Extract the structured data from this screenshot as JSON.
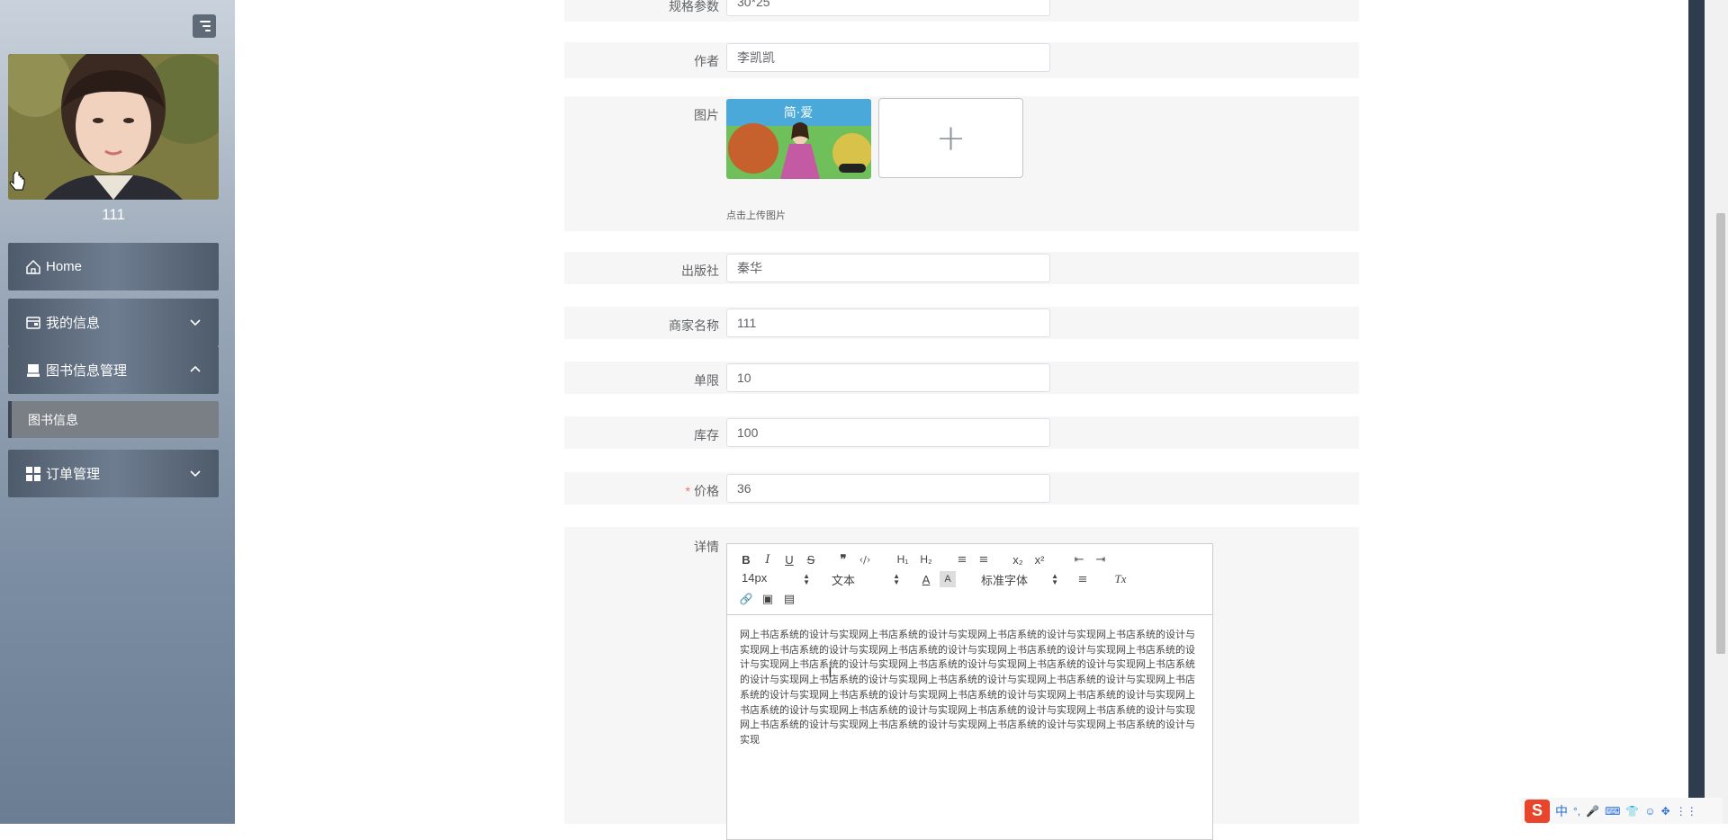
{
  "sidebar": {
    "username": "111",
    "nav": [
      {
        "label": "Home",
        "icon": "home-icon"
      },
      {
        "label": "我的信息",
        "icon": "wallet-icon"
      },
      {
        "label": "图书信息管理",
        "icon": "archive-icon"
      },
      {
        "label": "订单管理",
        "icon": "grid-icon"
      }
    ],
    "sub_item": {
      "label": "图书信息"
    }
  },
  "form": {
    "spec": {
      "label": "规格参数",
      "value": "30*25"
    },
    "author": {
      "label": "作者",
      "value": "李凯凯"
    },
    "image": {
      "label": "图片",
      "hint": "点击上传图片",
      "plus": "+",
      "cover_text": "简·爱"
    },
    "publisher": {
      "label": "出版社",
      "value": "秦华"
    },
    "merchant": {
      "label": "商家名称",
      "value": "111"
    },
    "limit": {
      "label": "单限",
      "value": "10"
    },
    "stock": {
      "label": "库存",
      "value": "100"
    },
    "price": {
      "label": "价格",
      "value": "36",
      "required_mark": "*"
    },
    "detail": {
      "label": "详情",
      "toolbar": {
        "bold": "B",
        "italic": "I",
        "underline": "U",
        "strike": "S",
        "quote": "❞",
        "code": "‹/›",
        "h1": "H₁",
        "h2": "H₂",
        "ordered": "≡",
        "bullet": "≡",
        "sub": "x₂",
        "sup": "x²",
        "outdent": "⇤",
        "indent": "⇥",
        "size": "14px",
        "format": "文本",
        "font": "标准字体",
        "color": "A",
        "bg": "A",
        "align": "≡",
        "clean": "Tx",
        "link": "🔗",
        "image": "▣",
        "video": "▤"
      },
      "content": "网上书店系统的设计与实现网上书店系统的设计与实现网上书店系统的设计与实现网上书店系统的设计与实现网上书店系统的设计与实现网上书店系统的设计与实现网上书店系统的设计与实现网上书店系统的设计与实现网上书店系统的设计与实现网上书店系统的设计与实现网上书店系统的设计与实现网上书店系统的设计与实现网上书店系统的设计与实现网上书店系统的设计与实现网上书店系统的设计与实现网上书店系统的设计与实现网上书店系统的设计与实现网上书店系统的设计与实现网上书店系统的设计与实现网上书店系统的设计与实现网上书店系统的设计与实现网上书店系统的设计与实现网上书店系统的设计与实现网上书店系统的设计与实现网上书店系统的设计与实现网上书店系统的设计与实现网上书店系统的设计与实现"
    }
  },
  "ime": {
    "logo": "S",
    "mode": "中"
  }
}
